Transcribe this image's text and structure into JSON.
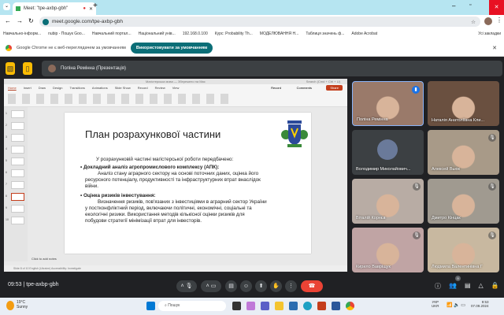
{
  "browser": {
    "tab_title": "Meet: \"tpe-axbp-gbh\"",
    "url": "meet.google.com/tpe-axbp-gbh",
    "bookmarks": [
      "Навчально-інформ...",
      "nubip - Пошук Goo...",
      "Навчальний портал...",
      "Національний унів...",
      "192.168.0.100",
      "Курс: Probability Th...",
      "МОДЕЛЮВАННЯ Н...",
      "Таблиця значень ф...",
      "Adobe Acrobat"
    ],
    "all_bookmarks": "Усі закладки",
    "infobar_text": "Google Chrome не є веб-переглядачем за умовчанням",
    "infobar_button": "Використовувати за умовчанням"
  },
  "meet": {
    "presenter_label": "Поліна Ремінна (Презентація)",
    "time": "09:53",
    "meeting_code": "tpe-axbp-gbh",
    "participants": [
      {
        "name": "Поліна Ремінна",
        "bg": "#9a7a6a",
        "speaking": true
      },
      {
        "name": "Наталія Анатоліївна Кли...",
        "bg": "#6a5040"
      },
      {
        "name": "Володимир Миколайович...",
        "bg": "#3c4043",
        "avatar": true
      },
      {
        "name": "Алексей Вьюк",
        "bg": "#a89a88"
      },
      {
        "name": "Віталій Корнєв",
        "bg": "#b8aca4"
      },
      {
        "name": "Дмитро Кінцак",
        "bg": "#a09a90"
      },
      {
        "name": "Кирило Вавріщук",
        "bg": "#c0a4a4"
      },
      {
        "name": "Людмила Валентинівна Г",
        "bg": "#c8b8a0"
      }
    ],
    "participant_count": "9"
  },
  "ppt": {
    "file_title": "Магістерська мова — Збережено на Mac",
    "search": "Search (Cmd + Ctrl + U)",
    "tabs": [
      "Home",
      "Insert",
      "Draw",
      "Design",
      "Transitions",
      "Animations",
      "Slide Show",
      "Record",
      "Review",
      "View"
    ],
    "record": "Record",
    "comments": "Comments",
    "share": "Share",
    "slide_numbers": [
      "1",
      "2",
      "3",
      "4",
      "5",
      "6",
      "7",
      "8",
      "9",
      "10"
    ],
    "notes_placeholder": "Click to add notes",
    "status": "Slide 8 of 10    English (Ukraine)    Accessibility: Investigate"
  },
  "slide": {
    "title": "План розрахункової частини",
    "intro": "У розрахунковій частині магістерської роботи передбачено:",
    "b1_head": "Докладний аналіз агропромислового комплексу (АПК):",
    "b1_l1": "Аналіз стану аграрного сектору на основі поточних даних, оцінка його",
    "b1_l2": "ресурсного потенціалу, продуктивності та інфраструктурних втрат внаслідок",
    "b1_l3": "війни.",
    "b2_head": "Оцінка ризиків інвестування:",
    "b2_l1": "Визначення ризиків, пов'язаних з інвестиціями в аграрний сектор України",
    "b2_l2": "у постконфліктний період, включаючи політичні, економічні, соціальні та",
    "b2_l3": "екологічні ризики. Використання методів кількісної оцінки ризиків для",
    "b2_l4": "побудови стратегії мінімізації втрат для інвесторів."
  },
  "taskbar": {
    "temp": "19°C",
    "weather": "Sunny",
    "search": "Пошук",
    "lang1": "УКР",
    "lang2": "UKR",
    "clock": "9:53",
    "date": "07.09.2024"
  }
}
